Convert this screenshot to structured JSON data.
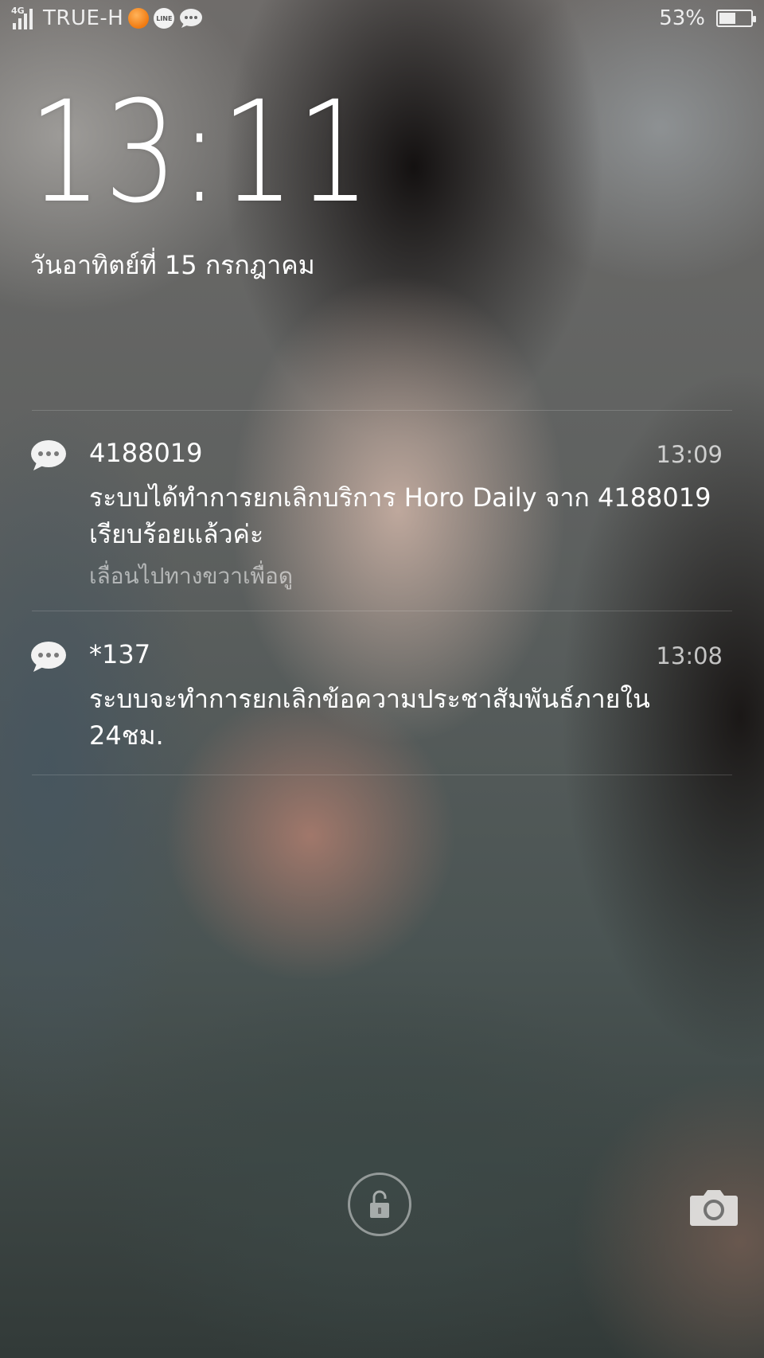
{
  "status_bar": {
    "network_type": "4G",
    "carrier": "TRUE-H",
    "battery_percent_text": "53%",
    "battery_level": 0.53,
    "notification_icons": [
      "orange-app-icon",
      "line-icon",
      "message-bubble-icon"
    ]
  },
  "lock_screen": {
    "time": "13:11",
    "date": "วันอาทิตย์ที่ 15 กรกฎาคม"
  },
  "notifications": [
    {
      "icon": "message-bubble-icon",
      "sender": "4188019",
      "time": "13:09",
      "body": "ระบบได้ทำการยกเลิกบริการ Horo Daily จาก 4188019 เรียบร้อยแล้วค่ะ",
      "hint": "เลื่อนไปทางขวาเพื่อดู"
    },
    {
      "icon": "message-bubble-icon",
      "sender": "*137",
      "time": "13:08",
      "body": "ระบบจะทำการยกเลิกข้อความประชาสัมพันธ์ภายใน 24ชม."
    }
  ],
  "actions": {
    "unlock_icon": "lock-open-icon",
    "camera_icon": "camera-icon"
  }
}
